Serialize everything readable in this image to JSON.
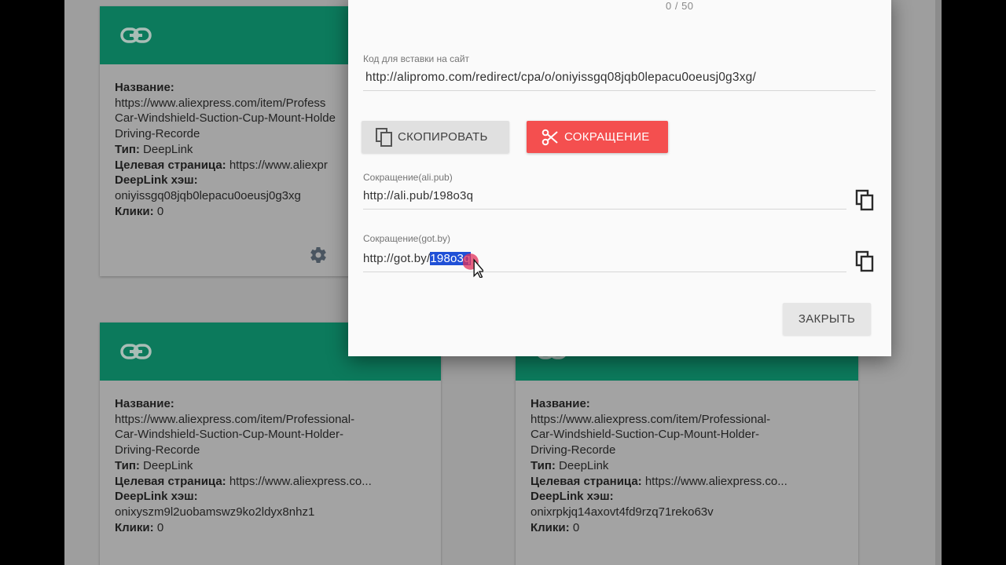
{
  "modal": {
    "counter": "0 / 50",
    "embed_label": "Код для вставки на сайт",
    "embed_value": "http://alipromo.com/redirect/cpa/o/oniyissgq08jqb0lepacu0oeusj0g3xg/",
    "copy_button": "СКОПИРОВАТЬ",
    "shorten_button": "СОКРАЩЕНИЕ",
    "alipub_label": "Сокращение(ali.pub)",
    "alipub_value": "http://ali.pub/198o3q",
    "gotby_label": "Сокращение(got.by)",
    "gotby_prefix": "http://got.by/",
    "gotby_selected": "198o3q",
    "close_button": "ЗАКРЫТЬ"
  },
  "cards": [
    {
      "name_label": "Название:",
      "name_lines": [
        "https://www.aliexpress.com/item/Profess",
        "Car-Windshield-Suction-Cup-Mount-Holde",
        "Driving-Recorde"
      ],
      "type_label": "Тип:",
      "type_value": "DeepLink",
      "target_label": "Целевая страница:",
      "target_value": "https://www.aliexpr",
      "hash_label": "DeepLink хэш:",
      "hash_value": "oniyissgq08jqb0lepacu0oeusj0g3xg",
      "clicks_label": "Клики:",
      "clicks_value": "0"
    },
    {
      "name_label": "Название:",
      "name_lines": [
        "https://www.aliexpress.com/item/Professional-",
        "Car-Windshield-Suction-Cup-Mount-Holder-",
        "Driving-Recorde"
      ],
      "type_label": "Тип:",
      "type_value": "DeepLink",
      "target_label": "Целевая страница:",
      "target_value": "https://www.aliexpress.co...",
      "hash_label": "DeepLink хэш:",
      "hash_value": "onixyszm9l2uobamswz9ko2ldyx8nhz1",
      "clicks_label": "Клики:",
      "clicks_value": "0"
    },
    {
      "name_label": "Название:",
      "name_lines": [
        "https://www.aliexpress.com/item/Professional-",
        "Car-Windshield-Suction-Cup-Mount-Holder-",
        "Driving-Recorde"
      ],
      "type_label": "Тип:",
      "type_value": "DeepLink",
      "target_label": "Целевая страница:",
      "target_value": "https://www.aliexpress.co...",
      "hash_label": "DeepLink хэш:",
      "hash_value": "onixrpkjq14axovt4fd9rzq71reko63v",
      "clicks_label": "Клики:",
      "clicks_value": "0"
    }
  ],
  "colors": {
    "card_header": "#0c7a5c",
    "shorten_button": "#f44f4f",
    "selection": "#2050d6"
  },
  "icons": [
    "link-icon",
    "gear-icon",
    "copy-icon",
    "scissors-icon",
    "mouse-cursor-icon"
  ]
}
